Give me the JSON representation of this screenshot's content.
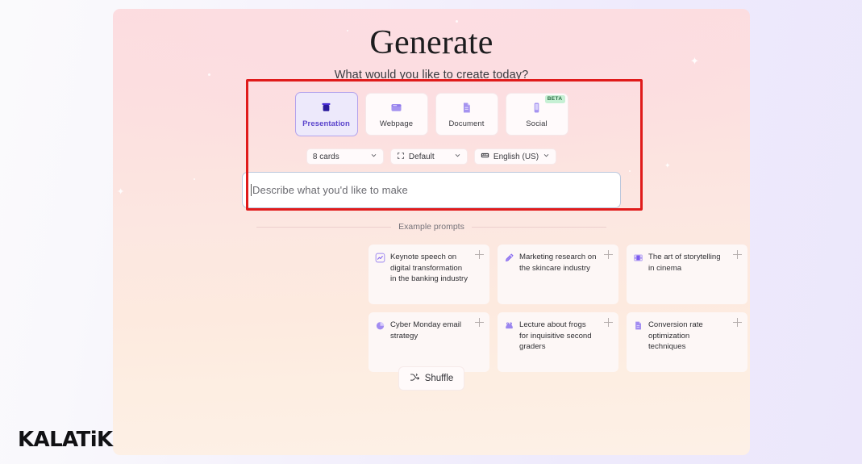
{
  "header": {
    "title": "Generate",
    "subtitle": "What would you like to create today?"
  },
  "formats": [
    {
      "label": "Presentation",
      "icon": "presentation-board-icon",
      "selected": true,
      "badge": ""
    },
    {
      "label": "Webpage",
      "icon": "browser-window-icon",
      "selected": false,
      "badge": ""
    },
    {
      "label": "Document",
      "icon": "document-page-icon",
      "selected": false,
      "badge": ""
    },
    {
      "label": "Social",
      "icon": "mobile-phone-icon",
      "selected": false,
      "badge": "BETA"
    }
  ],
  "options": {
    "cards": {
      "value": "8 cards",
      "icon": "chevron-down-icon"
    },
    "style": {
      "value": "Default",
      "icon": "frame-brackets-icon",
      "chevron": "chevron-down-icon"
    },
    "language": {
      "value": "English (US)",
      "icon": "keyboard-icon",
      "chevron": "chevron-down-icon"
    }
  },
  "prompt": {
    "placeholder": "Describe what you'd like to make",
    "value": ""
  },
  "examples": {
    "divider_label": "Example prompts",
    "items": [
      {
        "text": "Keynote speech on digital transformation in the banking industry",
        "icon": "line-chart-icon",
        "add": "plus-icon"
      },
      {
        "text": "Marketing research on the skincare industry",
        "icon": "pen-icon",
        "add": "plus-icon"
      },
      {
        "text": "The art of storytelling in cinema",
        "icon": "film-strip-icon",
        "add": "plus-icon"
      },
      {
        "text": "Cyber Monday email strategy",
        "icon": "pie-chart-icon",
        "add": "plus-icon"
      },
      {
        "text": "Lecture about frogs for inquisitive second graders",
        "icon": "frog-icon",
        "add": "plus-icon"
      },
      {
        "text": "Conversion rate optimization techniques",
        "icon": "document-icon",
        "add": "plus-icon"
      }
    ]
  },
  "shuffle": {
    "label": "Shuffle",
    "icon": "shuffle-icon"
  },
  "brand": {
    "name_upper": "KALAT",
    "name_lower": "i",
    "name_tail": "K"
  },
  "colors": {
    "accent_purple": "#7c5cf0",
    "selected_border": "#b3a2ec",
    "selected_bg": "#ede9fb",
    "beta_bg": "#c6f0d4",
    "beta_text": "#2b6b44",
    "panel_pink": "#fcdde1",
    "panel_peach": "#fdf0e6",
    "page_lavender": "#ece7fb",
    "annotation_red": "#e01b1b",
    "input_border": "#bcc8dd"
  }
}
